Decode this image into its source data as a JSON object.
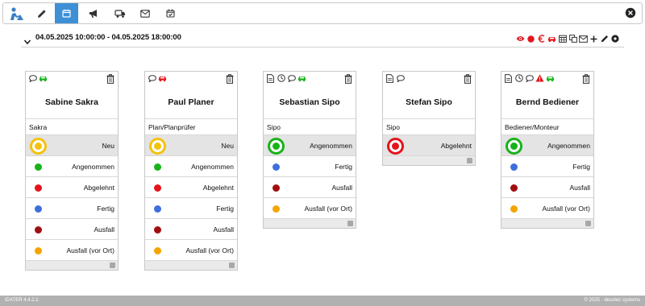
{
  "colors": {
    "accent": "#3d8fd6",
    "neu": "#f4c20d",
    "angenommen": "#17b31b",
    "abgelehnt": "#e3141c",
    "fertig": "#3f6fdc",
    "ausfall": "#a00f0f",
    "ausfall_vor_ort": "#f5a400"
  },
  "toolbar": {
    "icons": [
      "worker-icon",
      "pencil-icon",
      "calendar-icon",
      "megaphone-icon",
      "truck-chat-icon",
      "envelope-icon",
      "calendar-check-icon"
    ],
    "active": "calendar-icon"
  },
  "date_range": "04.05.2025 10:00:00 - 04.05.2025 18:00:00",
  "cards": [
    {
      "name": "Sabine Sakra",
      "role": "Sakra",
      "status_options": [
        {
          "label": "Neu",
          "status": "neu",
          "selected": true
        },
        {
          "label": "Angenommen",
          "status": "angenommen"
        },
        {
          "label": "Abgelehnt",
          "status": "abgelehnt"
        },
        {
          "label": "Fertig",
          "status": "fertig"
        },
        {
          "label": "Ausfall",
          "status": "ausfall"
        },
        {
          "label": "Ausfall (vor Ort)",
          "status": "ausfall_vor_ort"
        }
      ]
    },
    {
      "name": "Paul Planer",
      "role": "Plan/Planprüfer",
      "status_options": [
        {
          "label": "Neu",
          "status": "neu",
          "selected": true
        },
        {
          "label": "Angenommen",
          "status": "angenommen"
        },
        {
          "label": "Abgelehnt",
          "status": "abgelehnt"
        },
        {
          "label": "Fertig",
          "status": "fertig"
        },
        {
          "label": "Ausfall",
          "status": "ausfall"
        },
        {
          "label": "Ausfall (vor Ort)",
          "status": "ausfall_vor_ort"
        }
      ]
    },
    {
      "name": "Sebastian Sipo",
      "role": "Sipo",
      "status_options": [
        {
          "label": "Angenommen",
          "status": "angenommen",
          "selected": true
        },
        {
          "label": "Fertig",
          "status": "fertig"
        },
        {
          "label": "Ausfall",
          "status": "ausfall"
        },
        {
          "label": "Ausfall (vor Ort)",
          "status": "ausfall_vor_ort"
        }
      ]
    },
    {
      "name": "Stefan Sipo",
      "role": "Sipo",
      "status_options": [
        {
          "label": "Abgelehnt",
          "status": "abgelehnt",
          "selected": true
        }
      ]
    },
    {
      "name": "Bernd Bediener",
      "role": "Bediener/Monteur",
      "status_options": [
        {
          "label": "Angenommen",
          "status": "angenommen",
          "selected": true
        },
        {
          "label": "Fertig",
          "status": "fertig"
        },
        {
          "label": "Ausfall",
          "status": "ausfall"
        },
        {
          "label": "Ausfall (vor Ort)",
          "status": "ausfall_vor_ort"
        }
      ]
    }
  ],
  "footer": {
    "version": "IDATER 4.4.2.1",
    "copyright": "© 2025 · desotec systems"
  }
}
